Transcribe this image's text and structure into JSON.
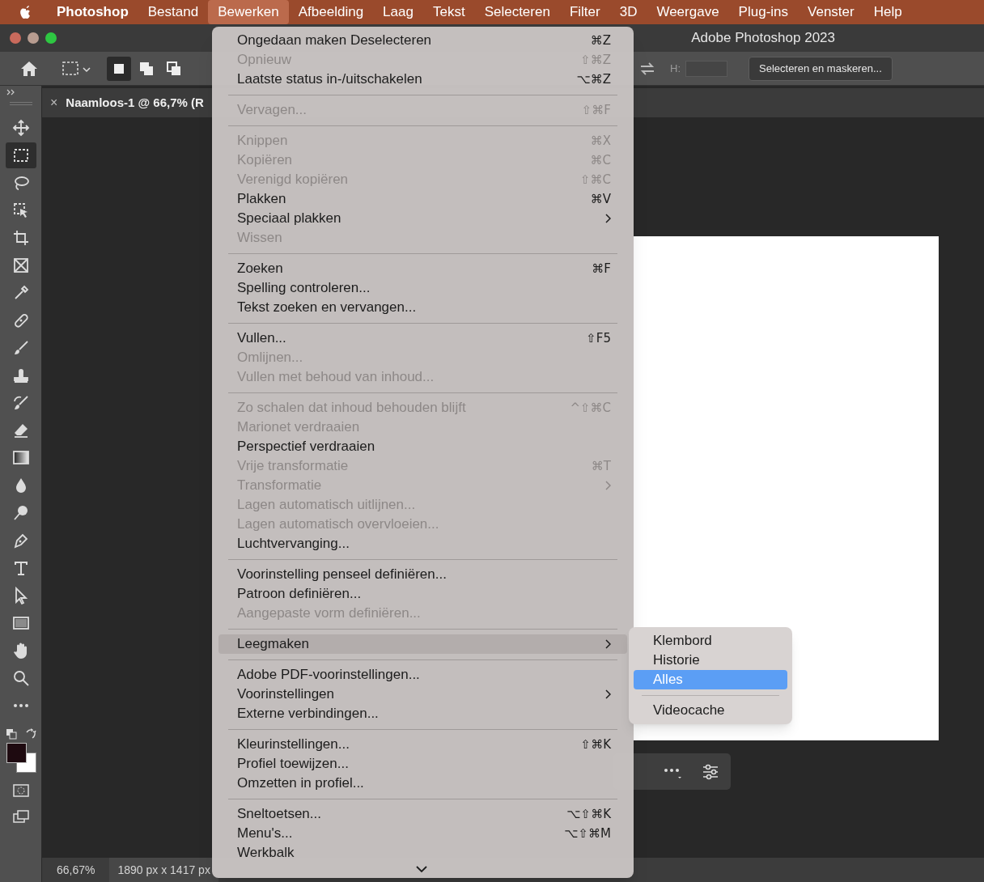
{
  "menubar": [
    {
      "label": "Photoshop",
      "kind": "app",
      "selected": false
    },
    {
      "label": "Bestand",
      "kind": "menu",
      "selected": false
    },
    {
      "label": "Bewerken",
      "kind": "menu",
      "selected": true
    },
    {
      "label": "Afbeelding",
      "kind": "menu",
      "selected": false
    },
    {
      "label": "Laag",
      "kind": "menu",
      "selected": false
    },
    {
      "label": "Tekst",
      "kind": "menu",
      "selected": false
    },
    {
      "label": "Selecteren",
      "kind": "menu",
      "selected": false
    },
    {
      "label": "Filter",
      "kind": "menu",
      "selected": false
    },
    {
      "label": "3D",
      "kind": "menu",
      "selected": false
    },
    {
      "label": "Weergave",
      "kind": "menu",
      "selected": false
    },
    {
      "label": "Plug-ins",
      "kind": "menu",
      "selected": false
    },
    {
      "label": "Venster",
      "kind": "menu",
      "selected": false
    },
    {
      "label": "Help",
      "kind": "menu",
      "selected": false
    }
  ],
  "window": {
    "title": "Adobe Photoshop 2023"
  },
  "options_bar": {
    "modes": [
      {
        "selected": true
      },
      {
        "selected": false
      },
      {
        "selected": false
      }
    ],
    "height_label": "H:",
    "button": "Selecteren en maskeren..."
  },
  "document_tab": {
    "close": "×",
    "title": "Naamloos-1 @ 66,7% (R"
  },
  "tools": [
    {
      "kind": "move",
      "selected": false
    },
    {
      "kind": "marquee",
      "selected": true
    },
    {
      "kind": "lasso",
      "selected": false
    },
    {
      "kind": "objectselect",
      "selected": false
    },
    {
      "kind": "crop",
      "selected": false
    },
    {
      "kind": "frame",
      "selected": false
    },
    {
      "kind": "eyedropper",
      "selected": false
    },
    {
      "kind": "healing",
      "selected": false
    },
    {
      "kind": "brush",
      "selected": false
    },
    {
      "kind": "stamp",
      "selected": false
    },
    {
      "kind": "historybrush",
      "selected": false
    },
    {
      "kind": "eraser",
      "selected": false
    },
    {
      "kind": "gradient",
      "selected": false
    },
    {
      "kind": "drop",
      "selected": false
    },
    {
      "kind": "dodge",
      "selected": false
    },
    {
      "kind": "pen",
      "selected": false
    },
    {
      "kind": "type",
      "selected": false
    },
    {
      "kind": "pathselect",
      "selected": false
    },
    {
      "kind": "rectangle",
      "selected": false
    },
    {
      "kind": "hand",
      "selected": false
    },
    {
      "kind": "zoom",
      "selected": false
    },
    {
      "kind": "more",
      "selected": false
    }
  ],
  "edit_menu": [
    [
      {
        "label": "Ongedaan maken Deselecteren",
        "shortcut": "⌘Z",
        "disabled": false,
        "submenu": false,
        "selected": false
      },
      {
        "label": "Opnieuw",
        "shortcut": "⇧⌘Z",
        "disabled": true,
        "submenu": false,
        "selected": false
      },
      {
        "label": "Laatste status in-/uitschakelen",
        "shortcut": "⌥⌘Z",
        "disabled": false,
        "submenu": false,
        "selected": false
      }
    ],
    [
      {
        "label": "Vervagen...",
        "shortcut": "⇧⌘F",
        "disabled": true,
        "submenu": false,
        "selected": false
      }
    ],
    [
      {
        "label": "Knippen",
        "shortcut": "⌘X",
        "disabled": true,
        "submenu": false,
        "selected": false
      },
      {
        "label": "Kopiëren",
        "shortcut": "⌘C",
        "disabled": true,
        "submenu": false,
        "selected": false
      },
      {
        "label": "Verenigd kopiëren",
        "shortcut": "⇧⌘C",
        "disabled": true,
        "submenu": false,
        "selected": false
      },
      {
        "label": "Plakken",
        "shortcut": "⌘V",
        "disabled": false,
        "submenu": false,
        "selected": false
      },
      {
        "label": "Speciaal plakken",
        "disabled": false,
        "submenu": true,
        "selected": false
      },
      {
        "label": "Wissen",
        "disabled": true,
        "submenu": false,
        "selected": false
      }
    ],
    [
      {
        "label": "Zoeken",
        "shortcut": "⌘F",
        "disabled": false,
        "submenu": false,
        "selected": false
      },
      {
        "label": "Spelling controleren...",
        "disabled": false,
        "submenu": false,
        "selected": false
      },
      {
        "label": "Tekst zoeken en vervangen...",
        "disabled": false,
        "submenu": false,
        "selected": false
      }
    ],
    [
      {
        "label": "Vullen...",
        "shortcut": "⇧F5",
        "disabled": false,
        "submenu": false,
        "selected": false
      },
      {
        "label": "Omlijnen...",
        "disabled": true,
        "submenu": false,
        "selected": false
      },
      {
        "label": "Vullen met behoud van inhoud...",
        "disabled": true,
        "submenu": false,
        "selected": false
      }
    ],
    [
      {
        "label": "Zo schalen dat inhoud behouden blijft",
        "shortcut": "^⇧⌘C",
        "disabled": true,
        "submenu": false,
        "selected": false
      },
      {
        "label": "Marionet verdraaien",
        "disabled": true,
        "submenu": false,
        "selected": false
      },
      {
        "label": "Perspectief verdraaien",
        "disabled": false,
        "submenu": false,
        "selected": false
      },
      {
        "label": "Vrije transformatie",
        "shortcut": "⌘T",
        "disabled": true,
        "submenu": false,
        "selected": false
      },
      {
        "label": "Transformatie",
        "disabled": true,
        "submenu": true,
        "selected": false
      },
      {
        "label": "Lagen automatisch uitlijnen...",
        "disabled": true,
        "submenu": false,
        "selected": false
      },
      {
        "label": "Lagen automatisch overvloeien...",
        "disabled": true,
        "submenu": false,
        "selected": false
      },
      {
        "label": "Luchtvervanging...",
        "disabled": false,
        "submenu": false,
        "selected": false
      }
    ],
    [
      {
        "label": "Voorinstelling penseel definiëren...",
        "disabled": false,
        "submenu": false,
        "selected": false
      },
      {
        "label": "Patroon definiëren...",
        "disabled": false,
        "submenu": false,
        "selected": false
      },
      {
        "label": "Aangepaste vorm definiëren...",
        "disabled": true,
        "submenu": false,
        "selected": false
      }
    ],
    [
      {
        "label": "Leegmaken",
        "disabled": false,
        "submenu": true,
        "selected": true
      }
    ],
    [
      {
        "label": "Adobe PDF-voorinstellingen...",
        "disabled": false,
        "submenu": false,
        "selected": false
      },
      {
        "label": "Voorinstellingen",
        "disabled": false,
        "submenu": true,
        "selected": false
      },
      {
        "label": "Externe verbindingen...",
        "disabled": false,
        "submenu": false,
        "selected": false
      }
    ],
    [
      {
        "label": "Kleurinstellingen...",
        "shortcut": "⇧⌘K",
        "disabled": false,
        "submenu": false,
        "selected": false
      },
      {
        "label": "Profiel toewijzen...",
        "disabled": false,
        "submenu": false,
        "selected": false
      },
      {
        "label": "Omzetten in profiel...",
        "disabled": false,
        "submenu": false,
        "selected": false
      }
    ],
    [
      {
        "label": "Sneltoetsen...",
        "shortcut": "⌥⇧⌘K",
        "disabled": false,
        "submenu": false,
        "selected": false
      },
      {
        "label": "Menu's...",
        "shortcut": "⌥⇧⌘M",
        "disabled": false,
        "submenu": false,
        "selected": false
      },
      {
        "label": "Werkbalk",
        "disabled": false,
        "submenu": false,
        "selected": false
      }
    ]
  ],
  "submenu": [
    [
      {
        "label": "Klembord",
        "selected": false
      },
      {
        "label": "Historie",
        "selected": false
      },
      {
        "label": "Alles",
        "selected": true
      }
    ],
    [
      {
        "label": "Videocache",
        "selected": false
      }
    ]
  ],
  "status_bar": {
    "zoom": "66,67%",
    "dimensions": "1890 px x 1417 px"
  }
}
